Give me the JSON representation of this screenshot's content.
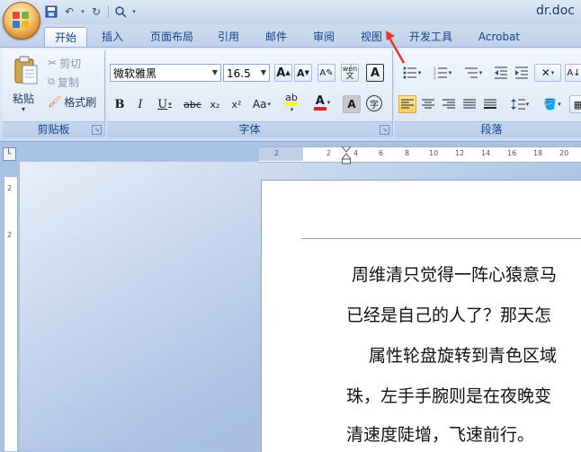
{
  "window": {
    "title": "dr.doc"
  },
  "qat": {
    "icons": [
      "save-icon",
      "undo-icon",
      "redo-icon",
      "customize-icon"
    ]
  },
  "tabs": [
    {
      "label": "开始",
      "active": true
    },
    {
      "label": "插入"
    },
    {
      "label": "页面布局"
    },
    {
      "label": "引用"
    },
    {
      "label": "邮件"
    },
    {
      "label": "审阅"
    },
    {
      "label": "视图"
    },
    {
      "label": "开发工具"
    },
    {
      "label": "Acrobat"
    }
  ],
  "clipboard": {
    "paste": "粘贴",
    "cut": "剪切",
    "copy": "复制",
    "format_painter": "格式刷",
    "label": "剪贴板"
  },
  "font": {
    "name": "微软雅黑",
    "size": "16.5",
    "label": "字体",
    "grow": "A",
    "shrink": "A",
    "phonetic": "wén",
    "bold": "B",
    "italic": "I",
    "underline": "U",
    "strike": "abc",
    "subscript": "x₂",
    "superscript": "x²",
    "case": "Aa",
    "highlight": "ab",
    "color": "A",
    "shade": "A",
    "enclose": "字"
  },
  "paragraph": {
    "label": "段落"
  },
  "ruler": {
    "numbers": [
      "2",
      "2",
      "4",
      "6",
      "8",
      "10",
      "12",
      "14",
      "16",
      "18",
      "20"
    ]
  },
  "document": {
    "lines": [
      "周维清只觉得一阵心猿意马",
      "已经是自己的人了？那天怎",
      "属性轮盘旋转到青色区域",
      "珠，左手手腕则是在夜晚变",
      "清速度陡增，飞速前行。"
    ]
  },
  "annotation": {
    "color": "#e8372a"
  },
  "theme": {
    "accent": "#15428b",
    "ribbon_bg": "#dbe7f6"
  }
}
